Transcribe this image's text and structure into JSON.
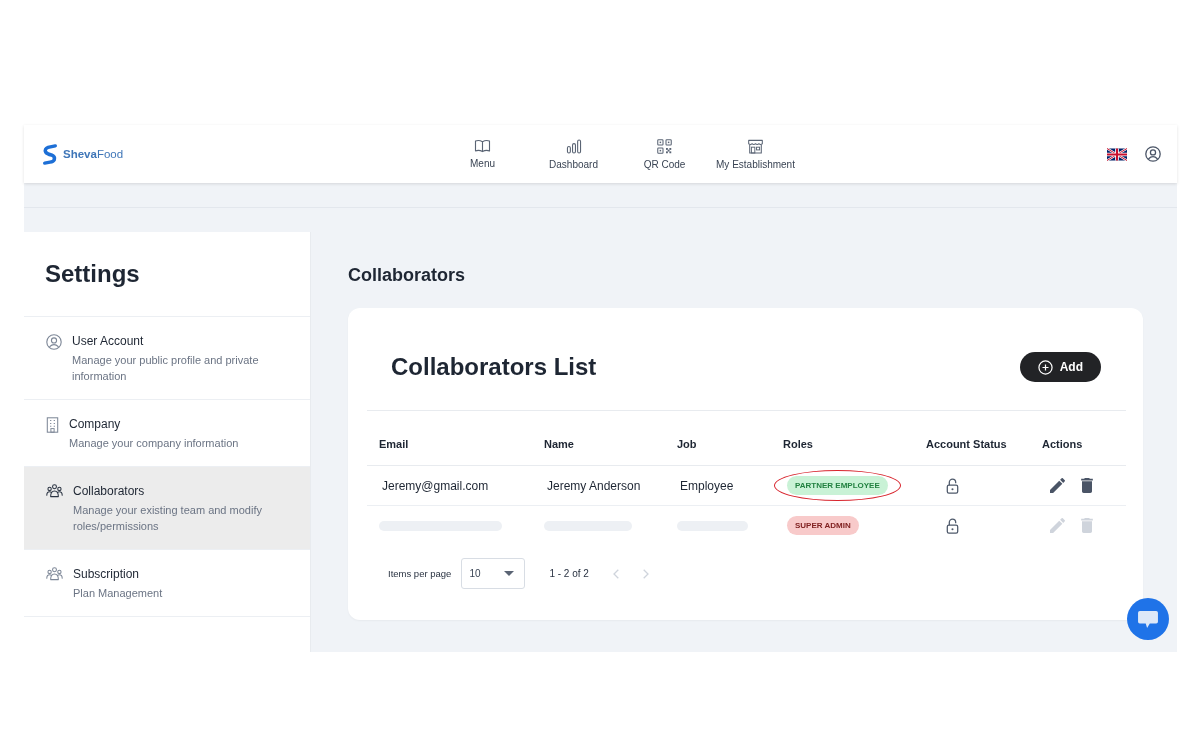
{
  "header": {
    "logo": "**Sheva**Food",
    "nav": [
      "Menu",
      "Dashboard",
      "QR Code",
      "My Establishment"
    ]
  },
  "sidebar": {
    "title": "Settings",
    "items": [
      {
        "title": "User Account",
        "description": "Manage your public profile and private information",
        "selected": false
      },
      {
        "title": "Company",
        "description": "Manage your company information",
        "selected": false
      },
      {
        "title": "Collaborators",
        "description": "Manage your existing team and modify roles/permissions",
        "selected": true
      },
      {
        "title": "Subscription",
        "description": "Plan Management",
        "selected": false
      }
    ]
  },
  "page_title": "Collaborators",
  "collaborators_card": {
    "title": "Collaborators List",
    "add_button": "Add",
    "table": {
      "columns": [
        "Email",
        "Name",
        "Job",
        "Roles",
        "Account Status",
        "Actions"
      ],
      "rows": [
        {
          "blurred": false,
          "email": "Jeremy@gmail.com",
          "name": "Jeremy Anderson",
          "job": "Employee",
          "role": {
            "label": "PARTNER EMPLOYEE",
            "color": "#c9f2d6",
            "highlighted": true
          },
          "disabled": false
        },
        {
          "blurred": true,
          "role": {
            "label": "SUPER ADMIN",
            "color": "#f8caca",
            "highlighted": false
          },
          "disabled": true
        }
      ]
    },
    "pagination": {
      "label": "Items per page",
      "page_size": "10",
      "range": "1 - 2 of 2",
      "previous": {
        "disabled": true
      },
      "next": {
        "disabled": true
      }
    }
  }
}
